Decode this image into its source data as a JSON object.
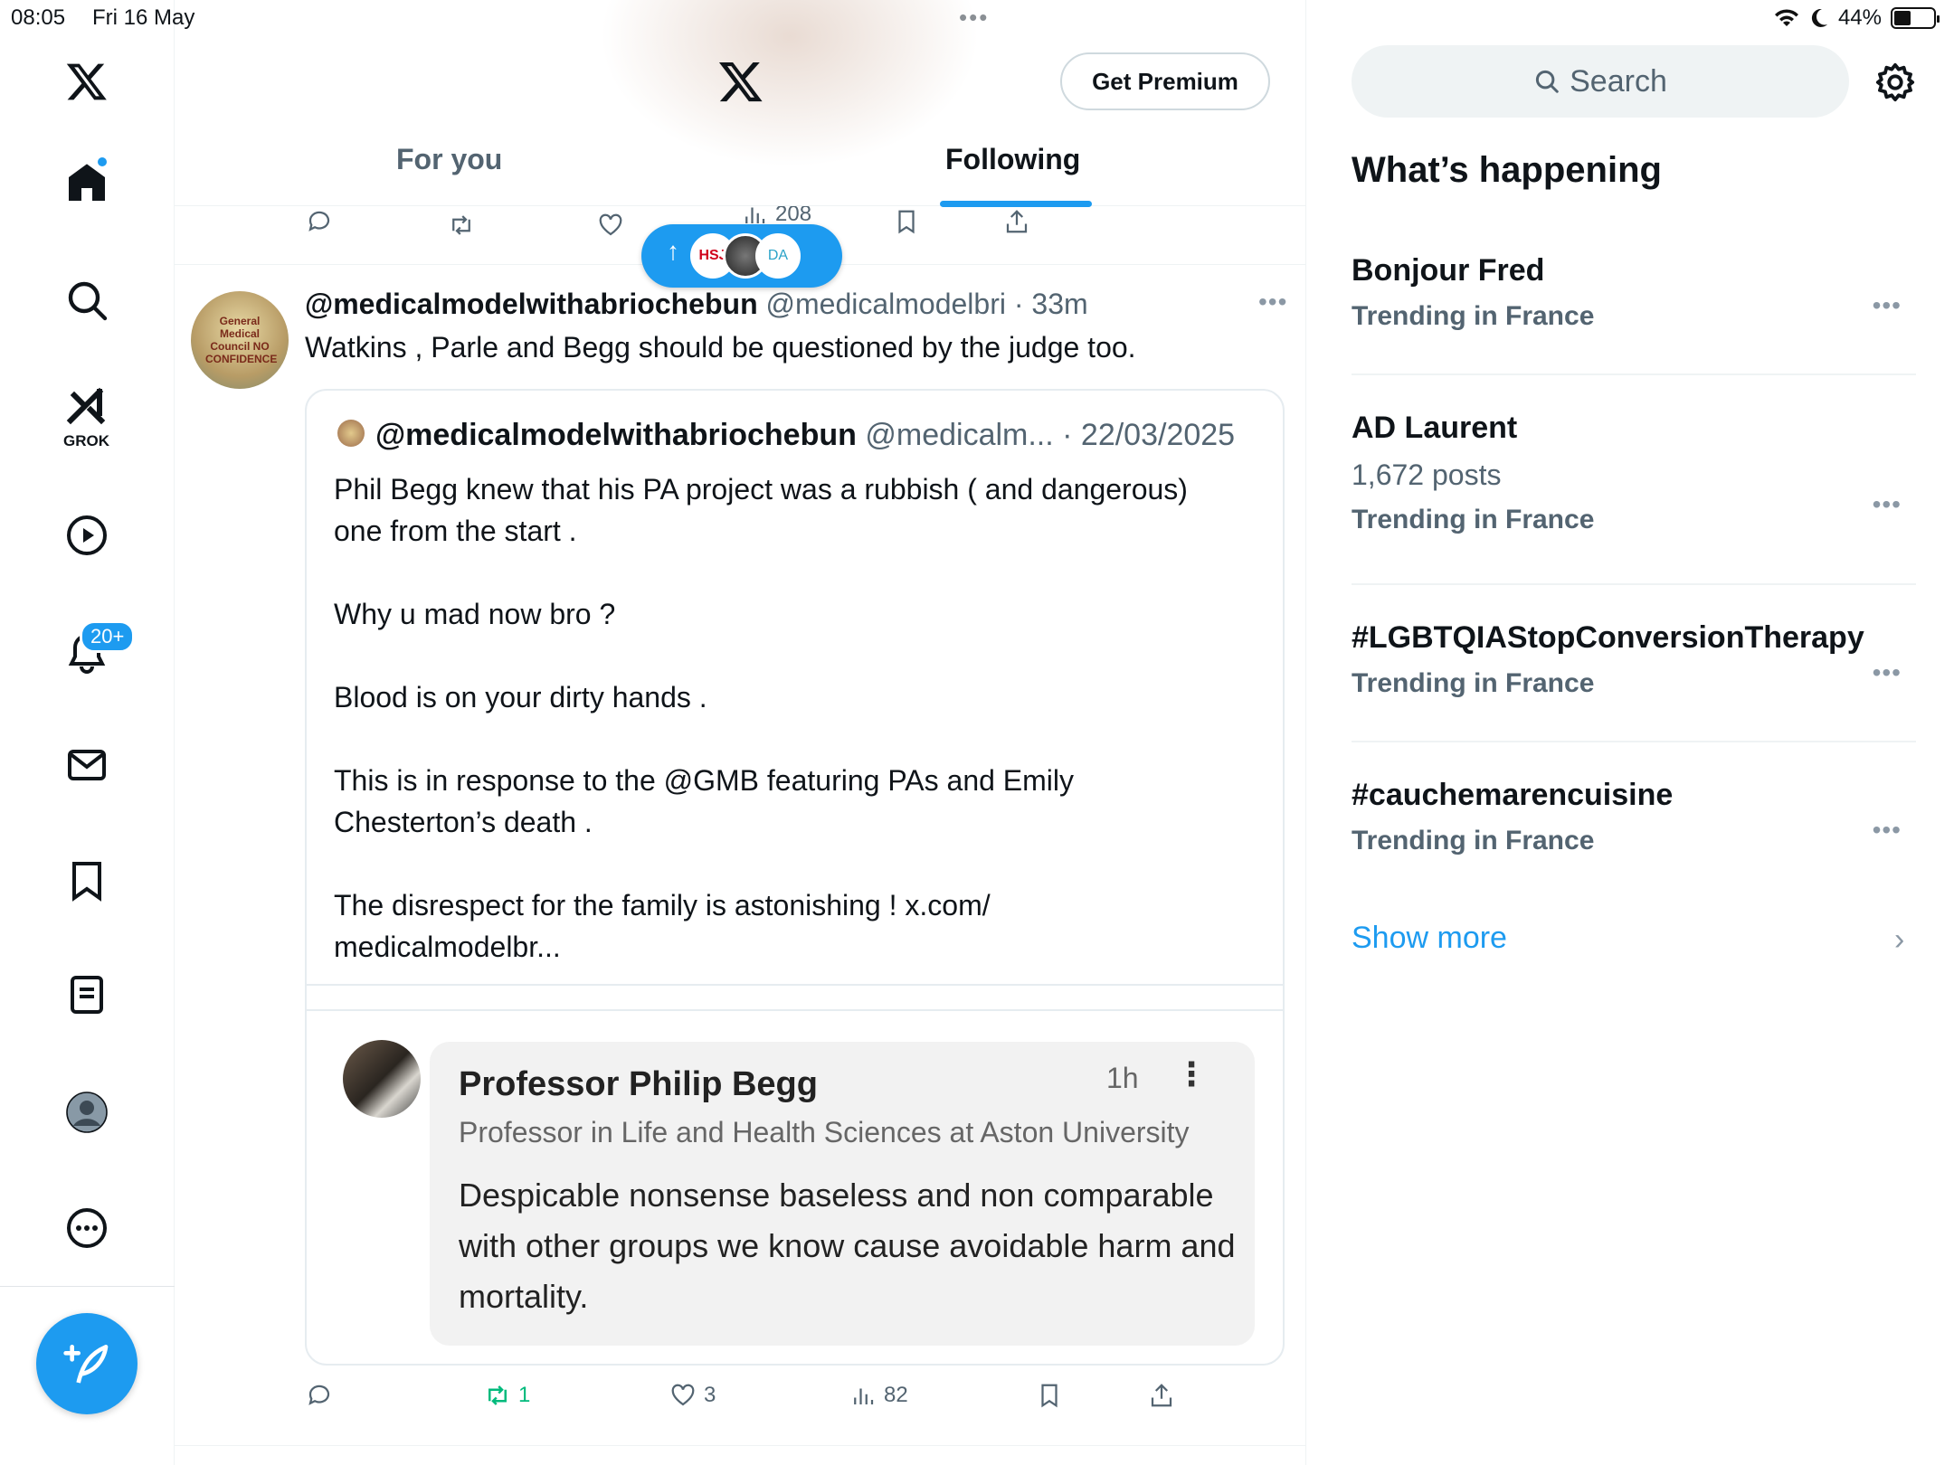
{
  "status_bar": {
    "time": "08:05",
    "date": "Fri 16 May",
    "battery": "44%",
    "battery_level": 0.44
  },
  "nav": {
    "notifications_badge": "20+",
    "grok_label": "GROK",
    "icons": [
      "x-logo",
      "home-icon",
      "search-icon",
      "grok-icon",
      "video-icon",
      "bell-icon",
      "mail-icon",
      "bookmark-icon",
      "lists-icon",
      "profile-icon",
      "more-icon",
      "compose-icon"
    ]
  },
  "header": {
    "premium_label": "Get Premium",
    "tabs": [
      {
        "label": "For you",
        "active": false
      },
      {
        "label": "Following",
        "active": true
      }
    ]
  },
  "top_actions": {
    "views": "208"
  },
  "new_posts_pill": {
    "avatars": [
      "HSJ",
      "",
      "DA"
    ]
  },
  "post": {
    "name": "@medicalmodelwithabriochebun",
    "handle": "@medicalmodelbri",
    "sep": " · ",
    "time": "33m",
    "text": "Watkins , Parle and Begg should be questioned by the judge too.",
    "avatar_text": "General Medical Council NO CONFIDENCE",
    "quote": {
      "name": "@medicalmodelwithabriochebun",
      "handle": "@medicalm...",
      "sep": " · ",
      "date": "22/03/2025",
      "body": "Phil Begg knew that his PA project was a rubbish ( and dangerous) one from the start .\n\nWhy u mad now bro ?\n\nBlood is on your dirty hands .\n\nThis is in response to the @GMB featuring PAs and Emily Chesterton’s death .\n\nThe disrespect for the family is astonishing ! x.com/\nmedicalmodelbr..."
    },
    "embed": {
      "name": "Professor Philip Begg",
      "time": "1h",
      "kebab": "⋮",
      "subtitle": "Professor in Life and Health Sciences at Aston University",
      "text": "Despicable nonsense baseless and non comparable with other groups we know cause avoidable harm and mortality."
    },
    "actions": {
      "reposts": "1",
      "likes": "3",
      "views": "82"
    }
  },
  "sidebar": {
    "search_placeholder": "Search",
    "whats_happening": "What’s happening",
    "trends": [
      {
        "name": "Bonjour Fred",
        "posts": "",
        "location": "Trending in France"
      },
      {
        "name": "AD Laurent",
        "posts": "1,672 posts",
        "location": "Trending in France"
      },
      {
        "name": "#LGBTQIAStopConversionTherapy",
        "posts": "",
        "location": "Trending in France"
      },
      {
        "name": "#cauchemarencuisine",
        "posts": "",
        "location": "Trending in France"
      }
    ],
    "more_glyph": "•••",
    "show_more": "Show more",
    "chevron": "›"
  },
  "colors": {
    "accent": "#1d9bf0",
    "repost_active": "#00ba7c",
    "text_secondary": "#536471"
  }
}
